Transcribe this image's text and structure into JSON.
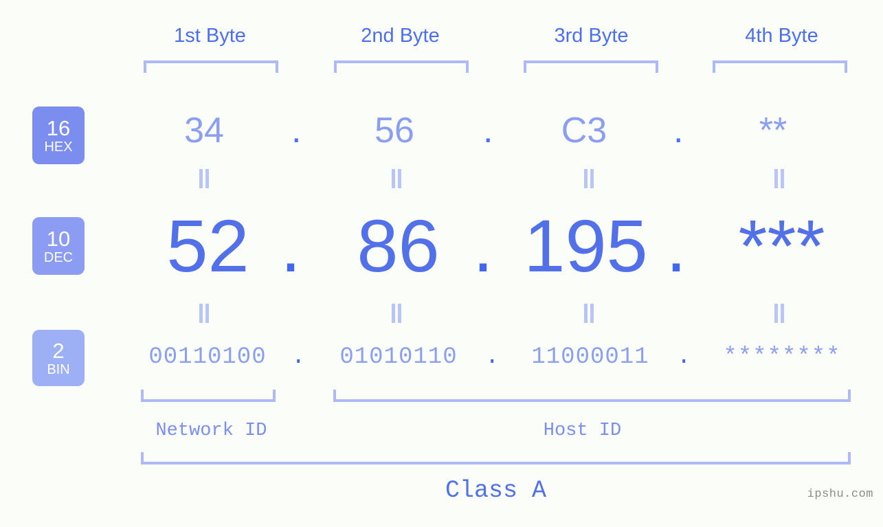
{
  "header": {
    "byte_labels": [
      "1st Byte",
      "2nd Byte",
      "3rd Byte",
      "4th Byte"
    ]
  },
  "bases": [
    {
      "number": "16",
      "name": "HEX",
      "color": "#7b8ef0"
    },
    {
      "number": "10",
      "name": "DEC",
      "color": "#8b9cf2"
    },
    {
      "number": "2",
      "name": "BIN",
      "color": "#9db0f6"
    }
  ],
  "rows": {
    "hex": {
      "base_number": "16",
      "base_name": "HEX",
      "values": [
        "34",
        "56",
        "C3",
        "**"
      ],
      "separator": "."
    },
    "dec": {
      "base_number": "10",
      "base_name": "DEC",
      "values": [
        "52",
        "86",
        "195",
        "***"
      ],
      "separator": "."
    },
    "bin": {
      "base_number": "2",
      "base_name": "BIN",
      "values": [
        "00110100",
        "01010110",
        "11000011",
        "********"
      ],
      "separator": "."
    }
  },
  "footer": {
    "network_id_label": "Network ID",
    "host_id_label": "Host ID",
    "class_label": "Class A"
  },
  "watermark": "ipshu.com",
  "colors": {
    "background": "#fbfdf8",
    "bracket": "#aebaf8",
    "hex_text": "#8b9ef0",
    "dec_text": "#5271e8",
    "bin_text": "#8b9ef0",
    "header_text": "#4e6ef2",
    "equals_mark": "#b9c4f7",
    "watermark_text": "#8b8b8b"
  }
}
